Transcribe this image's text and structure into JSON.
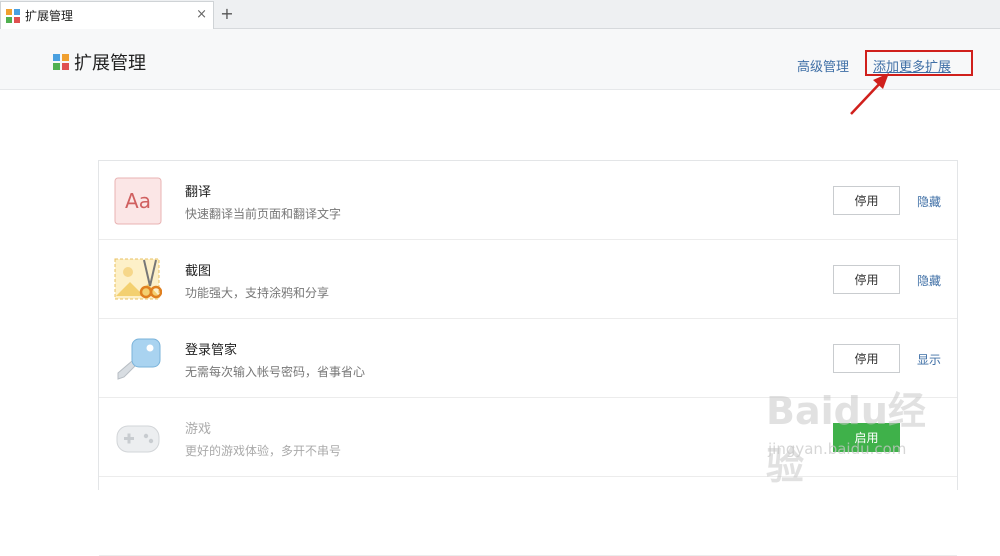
{
  "tab": {
    "title": "扩展管理",
    "close": "×",
    "new_tab": "+"
  },
  "header": {
    "title": "扩展管理",
    "advanced_link": "高级管理",
    "add_more_link": "添加更多扩展"
  },
  "extensions": [
    {
      "name": "翻译",
      "desc": "快速翻译当前页面和翻译文字",
      "button": "停用",
      "link": "隐藏",
      "icon": "translate-icon",
      "enabled": true
    },
    {
      "name": "截图",
      "desc": "功能强大，支持涂鸦和分享",
      "button": "停用",
      "link": "隐藏",
      "icon": "screenshot-icon",
      "enabled": true
    },
    {
      "name": "登录管家",
      "desc": "无需每次输入帐号密码，省事省心",
      "button": "停用",
      "link": "显示",
      "icon": "key-icon",
      "enabled": true
    },
    {
      "name": "游戏",
      "desc": "更好的游戏体验，多开不串号",
      "button": "启用",
      "link": "",
      "icon": "gamepad-icon",
      "enabled": false
    }
  ],
  "watermark": {
    "text": "Baidu经验",
    "sub": "jingyan.baidu.com"
  },
  "colors": {
    "accent_link": "#3f6fa6",
    "highlight_box": "#d0201c",
    "enable_button": "#3fb14a"
  }
}
